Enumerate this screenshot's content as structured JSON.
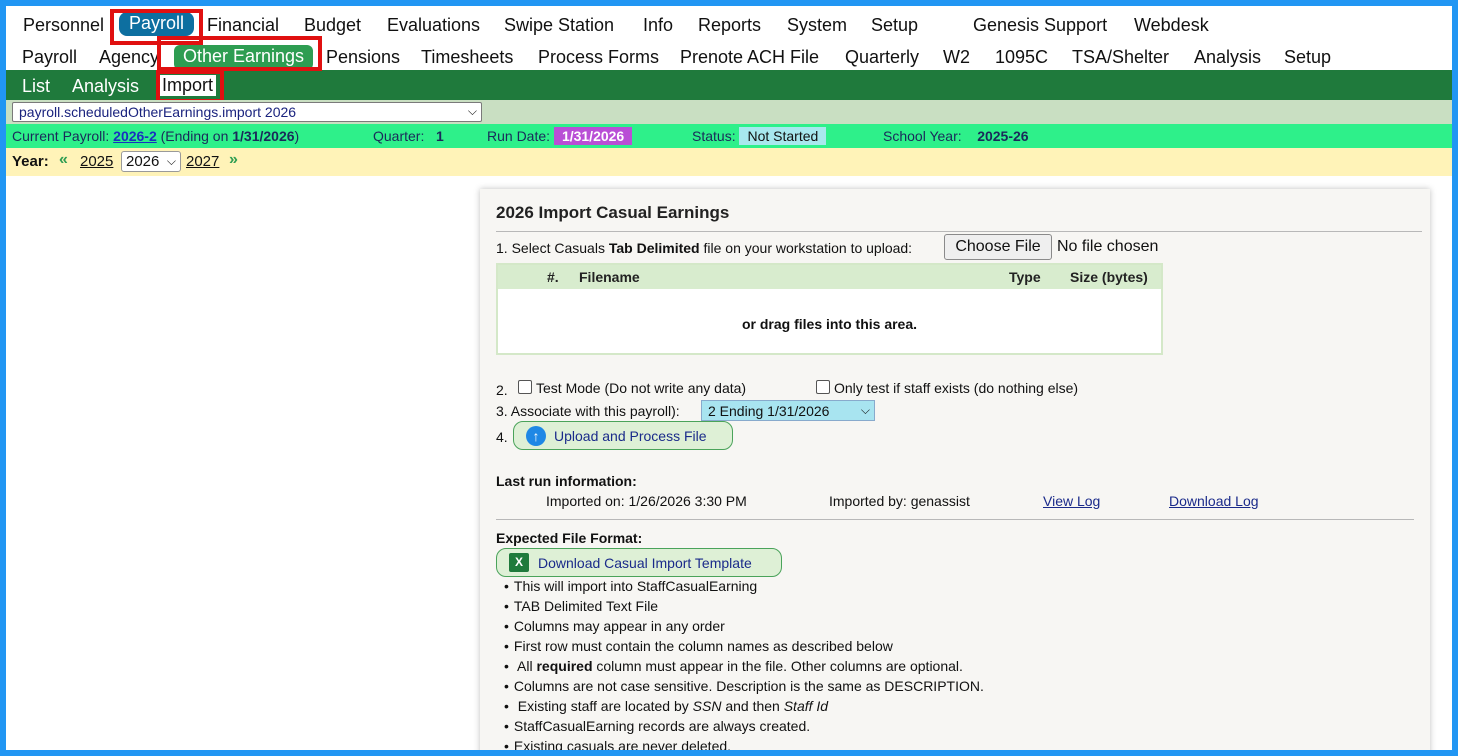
{
  "top_nav": {
    "items": [
      "Personnel",
      "Payroll",
      "Financial",
      "Budget",
      "Evaluations",
      "Swipe Station",
      "Info",
      "Reports",
      "System",
      "Setup",
      "Genesis Support",
      "Webdesk"
    ],
    "active": "Payroll"
  },
  "sub_nav": {
    "items": [
      "Payroll",
      "Agency",
      "Other Earnings",
      "Pensions",
      "Timesheets",
      "Process Forms",
      "Prenote ACH File",
      "Quarterly",
      "W2",
      "1095C",
      "TSA/Shelter",
      "Analysis",
      "Setup"
    ],
    "active": "Other Earnings"
  },
  "third_nav": {
    "items": [
      "List",
      "Analysis",
      "Import"
    ],
    "active": "Import"
  },
  "program_select": "payroll.scheduledOtherEarnings.import 2026",
  "info_bar": {
    "current_payroll_label": "Current Payroll:",
    "current_payroll_link": "2026-2",
    "ending_prefix": "(Ending on",
    "ending_date": "1/31/2026",
    "ending_suffix": ")",
    "quarter_label": "Quarter:",
    "quarter_value": "1",
    "run_date_label": "Run Date:",
    "run_date_value": "1/31/2026",
    "status_label": "Status:",
    "status_value": "Not Started",
    "school_year_label": "School Year:",
    "school_year_value": "2025-26"
  },
  "year_bar": {
    "label": "Year:",
    "prev_year": "2025",
    "selected_year": "2026",
    "next_year": "2027"
  },
  "panel": {
    "title": "2026 Import Casual Earnings",
    "step1_prefix": "1. Select Casuals",
    "step1_bold": "Tab Delimited",
    "step1_suffix": "file on your workstation to upload:",
    "choose_file": "Choose File",
    "no_file": "No file chosen",
    "table_headers": {
      "num": "#.",
      "filename": "Filename",
      "type": "Type",
      "size": "Size (bytes)"
    },
    "drop_message": "or drag files into this area.",
    "step2_num": "2.",
    "test_mode_label": "Test Mode (Do not write any data)",
    "only_test_label": "Only test if staff exists (do nothing else)",
    "step3_label": "3. Associate with this payroll):",
    "payroll_option": "2 Ending 1/31/2026",
    "step4_num": "4.",
    "upload_button": "Upload and Process File",
    "last_run_label": "Last run information:",
    "imported_on": "Imported on: 1/26/2026 3:30 PM",
    "imported_by": "Imported by: genassist",
    "view_log": "View Log",
    "download_log": "Download Log",
    "expected_format_label": "Expected File Format:",
    "download_template": "Download Casual Import Template",
    "bullets": [
      "This will import into StaffCasualEarning",
      "TAB Delimited Text File",
      "Columns may appear in any order",
      "First row must contain the column names as described below"
    ],
    "bullet_required_pre": "All",
    "bullet_required_bold": "required",
    "bullet_required_post": "column must appear in the file. Other columns are optional.",
    "bullet_case": "Columns are not case sensitive. Description is the same as DESCRIPTION.",
    "bullet_staff_pre": "Existing staff are located by",
    "bullet_staff_ssn": "SSN",
    "bullet_staff_mid": "and then",
    "bullet_staff_id": "Staff Id",
    "bullet_created": "StaffCasualEarning records are always created.",
    "bullet_never_deleted": "Existing casuals are never deleted."
  },
  "colors": {
    "frame_border": "#2196f3",
    "top_active": "#0d6fa0",
    "sub_active": "#2e9d52",
    "third_nav_bg": "#1f7a3c",
    "info_bg": "#2ef08a",
    "year_bg": "#fff3b8",
    "highlight_box": "#e01010"
  }
}
